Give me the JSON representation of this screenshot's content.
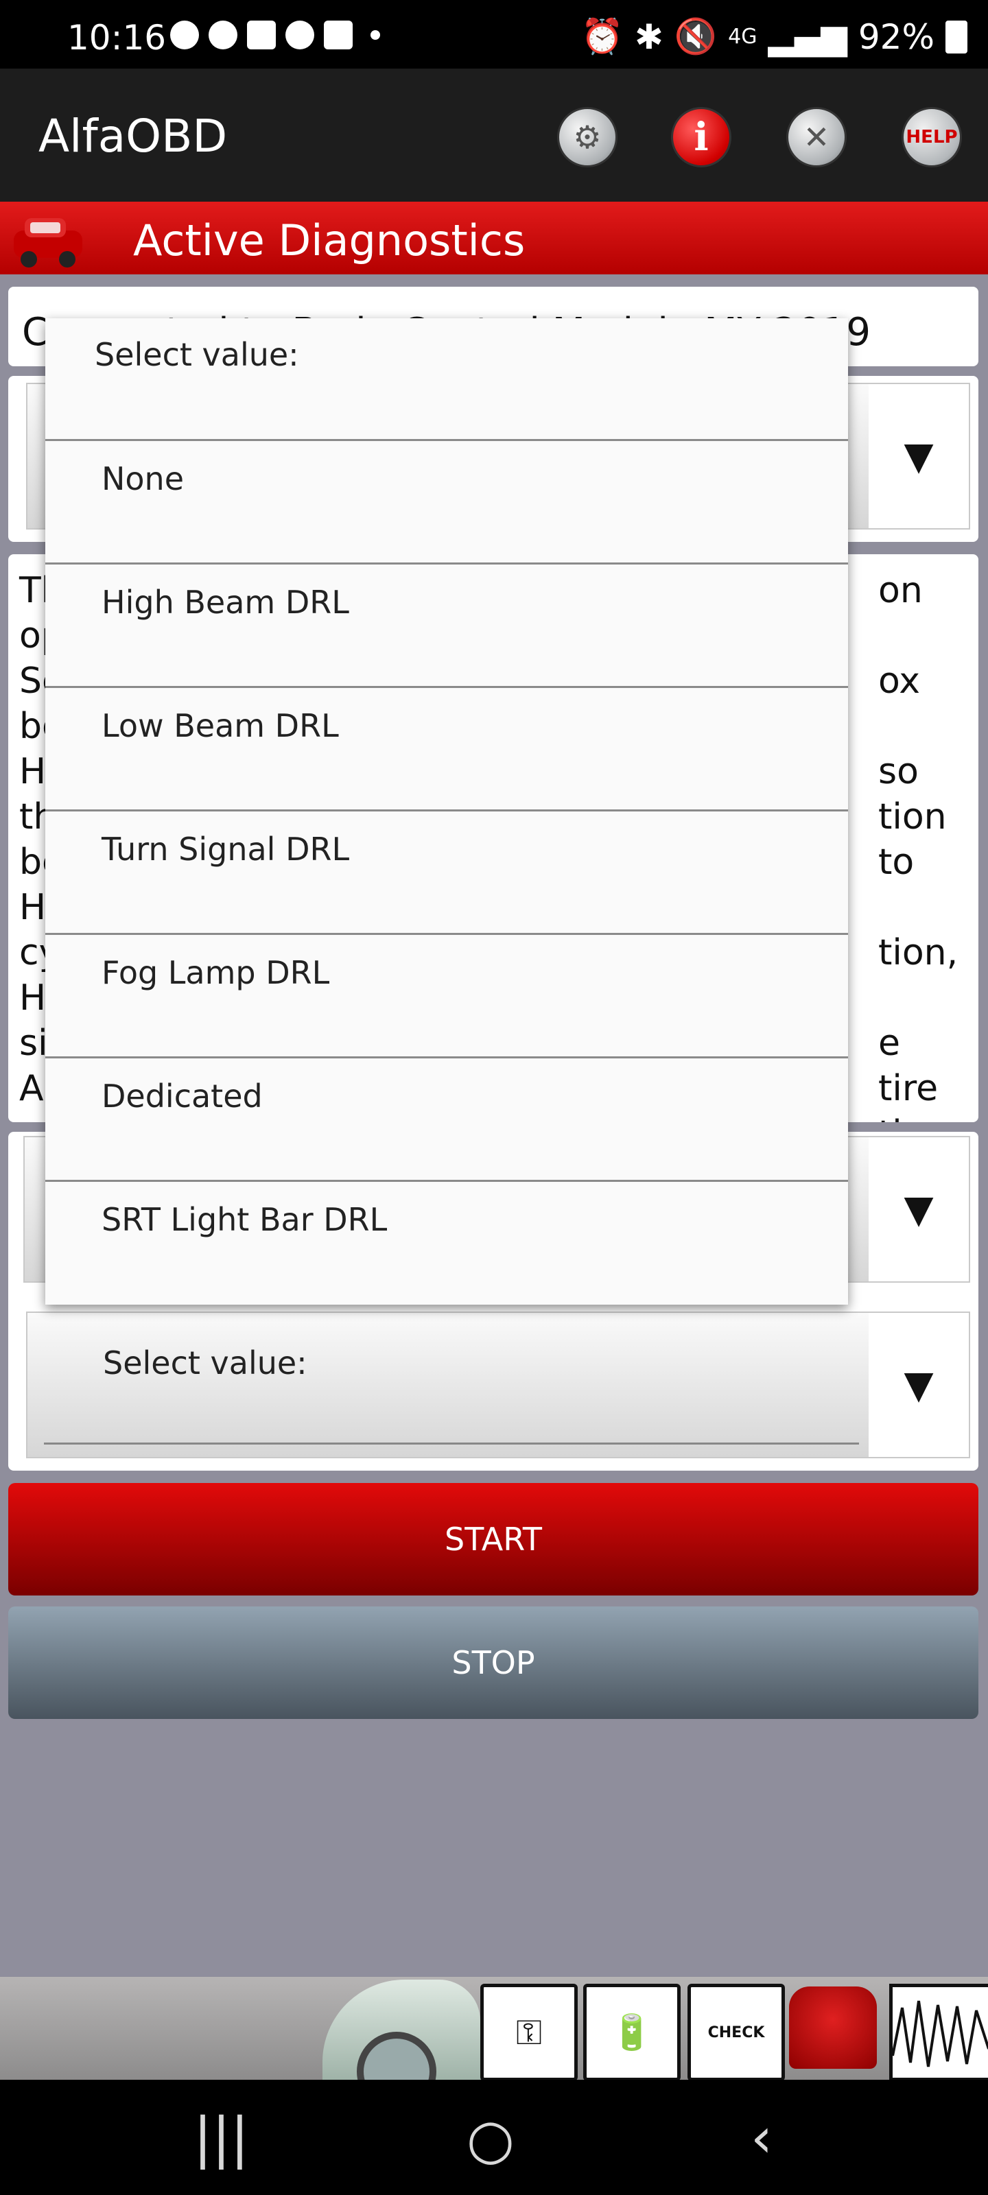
{
  "status_bar": {
    "time": "10:16",
    "battery": "92%",
    "network": "4G"
  },
  "app_bar": {
    "title": "AlfaOBD",
    "settings_icon": "gears-icon",
    "info_icon": "info-icon",
    "tools_icon": "tools-icon",
    "help_label": "HELP"
  },
  "header": {
    "title": "Active Diagnostics"
  },
  "connection": {
    "text": "Connected to Body Control Module MY 2019"
  },
  "description": {
    "left_column": [
      "Th",
      "op",
      "Se",
      "be",
      "H",
      "th",
      "be",
      "H",
      "cy",
      "H",
      "si",
      "A"
    ],
    "right_column": [
      "on",
      "",
      "ox",
      "",
      "so",
      "tion to",
      "",
      "tion,",
      "",
      "e tire",
      "the",
      ""
    ]
  },
  "spinner_bottom": {
    "label": "Select value:"
  },
  "buttons": {
    "start": "START",
    "stop": "STOP"
  },
  "dialog": {
    "title": "Select value:",
    "options": [
      "None",
      "High Beam DRL",
      "Low Beam DRL",
      "Turn Signal DRL",
      "Fog Lamp DRL",
      "Dedicated",
      "SRT Light Bar DRL"
    ]
  },
  "bottom_strip": {
    "check_label": "CHECK"
  },
  "colors": {
    "header_red": "#d10000",
    "app_bar": "#1d1d1d",
    "background": "#8f8e9c",
    "start_red": "#b80000",
    "stop_gray": "#6b7884"
  }
}
